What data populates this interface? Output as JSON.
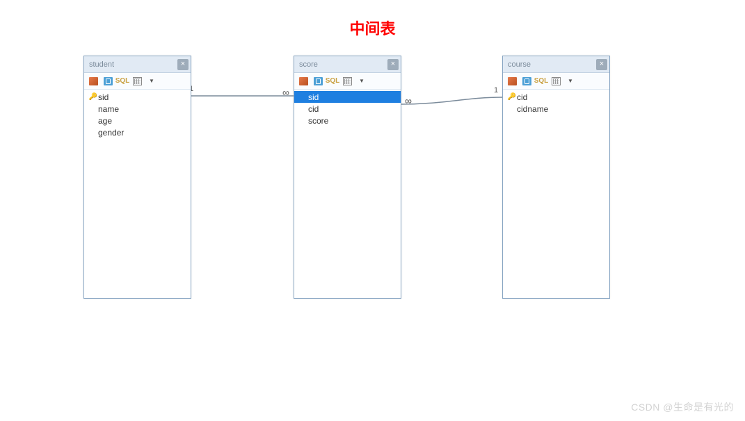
{
  "title": "中间表",
  "watermark": "CSDN @生命是有光的",
  "relations": {
    "left": {
      "one": "1",
      "many": "∞"
    },
    "right": {
      "one": "1",
      "many": "∞"
    }
  },
  "tables": {
    "student": {
      "name": "student",
      "fields": [
        {
          "label": "sid",
          "isKey": true,
          "selected": false
        },
        {
          "label": "name",
          "isKey": false,
          "selected": false
        },
        {
          "label": "age",
          "isKey": false,
          "selected": false
        },
        {
          "label": "gender",
          "isKey": false,
          "selected": false
        }
      ]
    },
    "score": {
      "name": "score",
      "fields": [
        {
          "label": "sid",
          "isKey": false,
          "selected": true
        },
        {
          "label": "cid",
          "isKey": false,
          "selected": false
        },
        {
          "label": "score",
          "isKey": false,
          "selected": false
        }
      ]
    },
    "course": {
      "name": "course",
      "fields": [
        {
          "label": "cid",
          "isKey": true,
          "selected": false
        },
        {
          "label": "cidname",
          "isKey": false,
          "selected": false
        }
      ]
    }
  }
}
